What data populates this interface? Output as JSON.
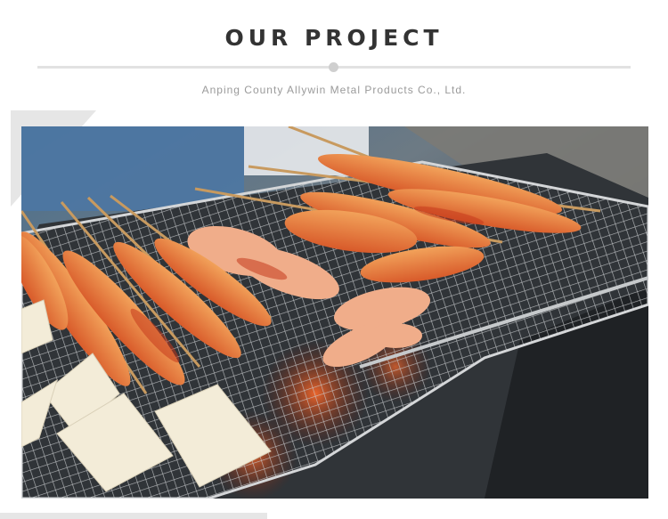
{
  "section": {
    "title": "OUR PROJECT",
    "company_subtitle": "Anping County Allywin Metal Products Co., Ltd."
  },
  "photo": {
    "subject": "bbq-grill-skewers-image"
  },
  "colors": {
    "title": "#333333",
    "subtitle": "#9a9a9a",
    "divider": "#e2e2e2",
    "divider_dot": "#cfcfcf",
    "decor_gray": "#e6e6e6"
  }
}
